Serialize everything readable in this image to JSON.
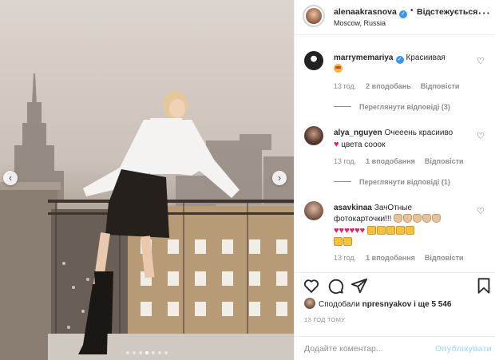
{
  "post": {
    "header": {
      "username": "alenaakrasnova",
      "verified_icon": "verified-badge-icon",
      "separator": "•",
      "follow_status": "Відстежується",
      "location": "Moscow, Russia",
      "more_icon": "more-options-icon"
    },
    "photo": {
      "nav_prev_icon": "chevron-left-icon",
      "nav_next_icon": "chevron-right-icon",
      "carousel": {
        "count": 7,
        "active_index": 3
      }
    },
    "comments": [
      {
        "username": "marrymemariya",
        "verified": true,
        "text": "Красиивая",
        "emoji_line": "face-with-heart-eyes",
        "time": "13 год.",
        "likes": "2 вподобань",
        "reply_label": "Відповісти",
        "view_replies": "Переглянути відповіді (3)"
      },
      {
        "username": "alya_nguyen",
        "verified": false,
        "text": "Очееень красииво",
        "text2": "цвета сооок",
        "time": "13 год.",
        "likes": "1 вподобання",
        "reply_label": "Відповісти",
        "view_replies": "Переглянути відповіді (1)"
      },
      {
        "username": "asavkinaa",
        "verified": false,
        "text": "ЗачОтные",
        "text2": "фотокарточки!!!",
        "time": "13 год.",
        "likes": "1 вподобання",
        "reply_label": "Відповісти"
      }
    ],
    "actions": {
      "like_icon": "heart-icon",
      "comment_icon": "comment-icon",
      "share_icon": "send-icon",
      "save_icon": "bookmark-icon"
    },
    "likes_summary": {
      "prefix": "Сподобали",
      "user": "npresnyakov",
      "suffix": "і ще 5 546"
    },
    "time_ago": "13 ГОД ТОМУ",
    "add_comment": {
      "placeholder": "Додайте коментар...",
      "publish_label": "Опублікувати"
    },
    "colors": {
      "text": "#262626",
      "muted": "#8e8e8e",
      "link_disabled": "#b2dffc",
      "verified": "#3897f0",
      "heart_red": "#e0245e"
    }
  }
}
